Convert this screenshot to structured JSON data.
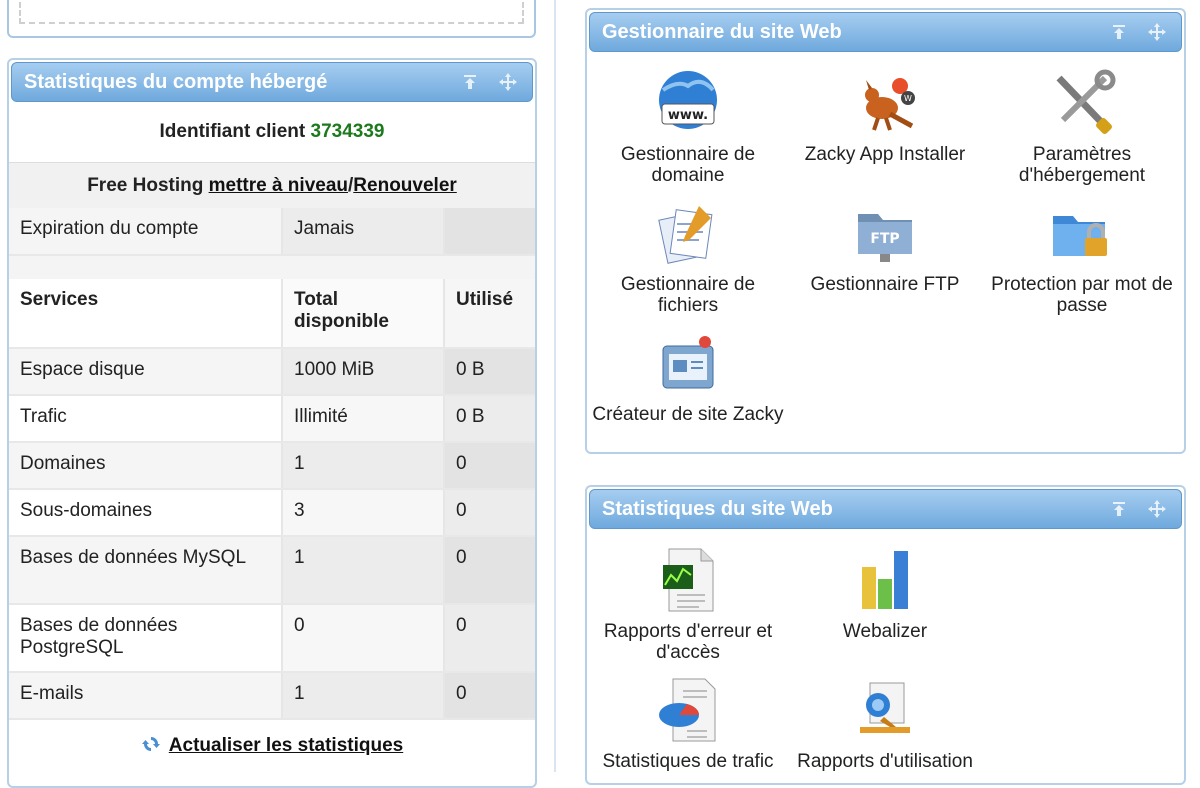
{
  "stats": {
    "title": "Statistiques du compte hébergé",
    "client_label": "Identifiant client",
    "client_id": "3734339",
    "plan": "Free Hosting",
    "upgrade_link": "mettre à niveau",
    "separator": "/",
    "renew_link": "Renouveler",
    "expiry_label": "Expiration du compte",
    "expiry_value": "Jamais",
    "headers": {
      "services": "Services",
      "total": "Total disponible",
      "used": "Utilisé"
    },
    "rows": [
      {
        "service": "Espace disque",
        "total": "1000 MiB",
        "used": "0 B"
      },
      {
        "service": "Trafic",
        "total": "Illimité",
        "used": "0 B"
      },
      {
        "service": "Domaines",
        "total": "1",
        "used": "0"
      },
      {
        "service": "Sous-domaines",
        "total": "3",
        "used": "0"
      },
      {
        "service": "Bases de données MySQL",
        "total": "1",
        "used": "0"
      },
      {
        "service": "Bases de données PostgreSQL",
        "total": "0",
        "used": "0"
      },
      {
        "service": "E-mails",
        "total": "1",
        "used": "0"
      }
    ],
    "refresh_label": "Actualiser les statistiques"
  },
  "manager": {
    "title": "Gestionnaire du site Web",
    "tiles": [
      {
        "label": "Gestionnaire de domaine",
        "icon": "globe-www-icon"
      },
      {
        "label": "Zacky App Installer",
        "icon": "kangaroo-icon"
      },
      {
        "label": "Paramètres d'hébergement",
        "icon": "tools-icon"
      },
      {
        "label": "Gestionnaire de fichiers",
        "icon": "files-icon"
      },
      {
        "label": "Gestionnaire FTP",
        "icon": "ftp-folder-icon"
      },
      {
        "label": "Protection par mot de passe",
        "icon": "lock-folder-icon"
      },
      {
        "label": "Créateur de site Zacky",
        "icon": "site-builder-icon"
      }
    ]
  },
  "webstats": {
    "title": "Statistiques du site Web",
    "tiles": [
      {
        "label": "Rapports d'erreur et d'accès",
        "icon": "report-chart-icon"
      },
      {
        "label": "Webalizer",
        "icon": "bar-chart-icon"
      },
      {
        "label": "Statistiques de trafic",
        "icon": "pie-report-icon"
      },
      {
        "label": "Rapports d'utilisation",
        "icon": "usage-report-icon"
      }
    ]
  },
  "colors": {
    "header_start": "#a6cdf0",
    "header_end": "#6fa9dd",
    "client_id": "#1c7a1c"
  }
}
